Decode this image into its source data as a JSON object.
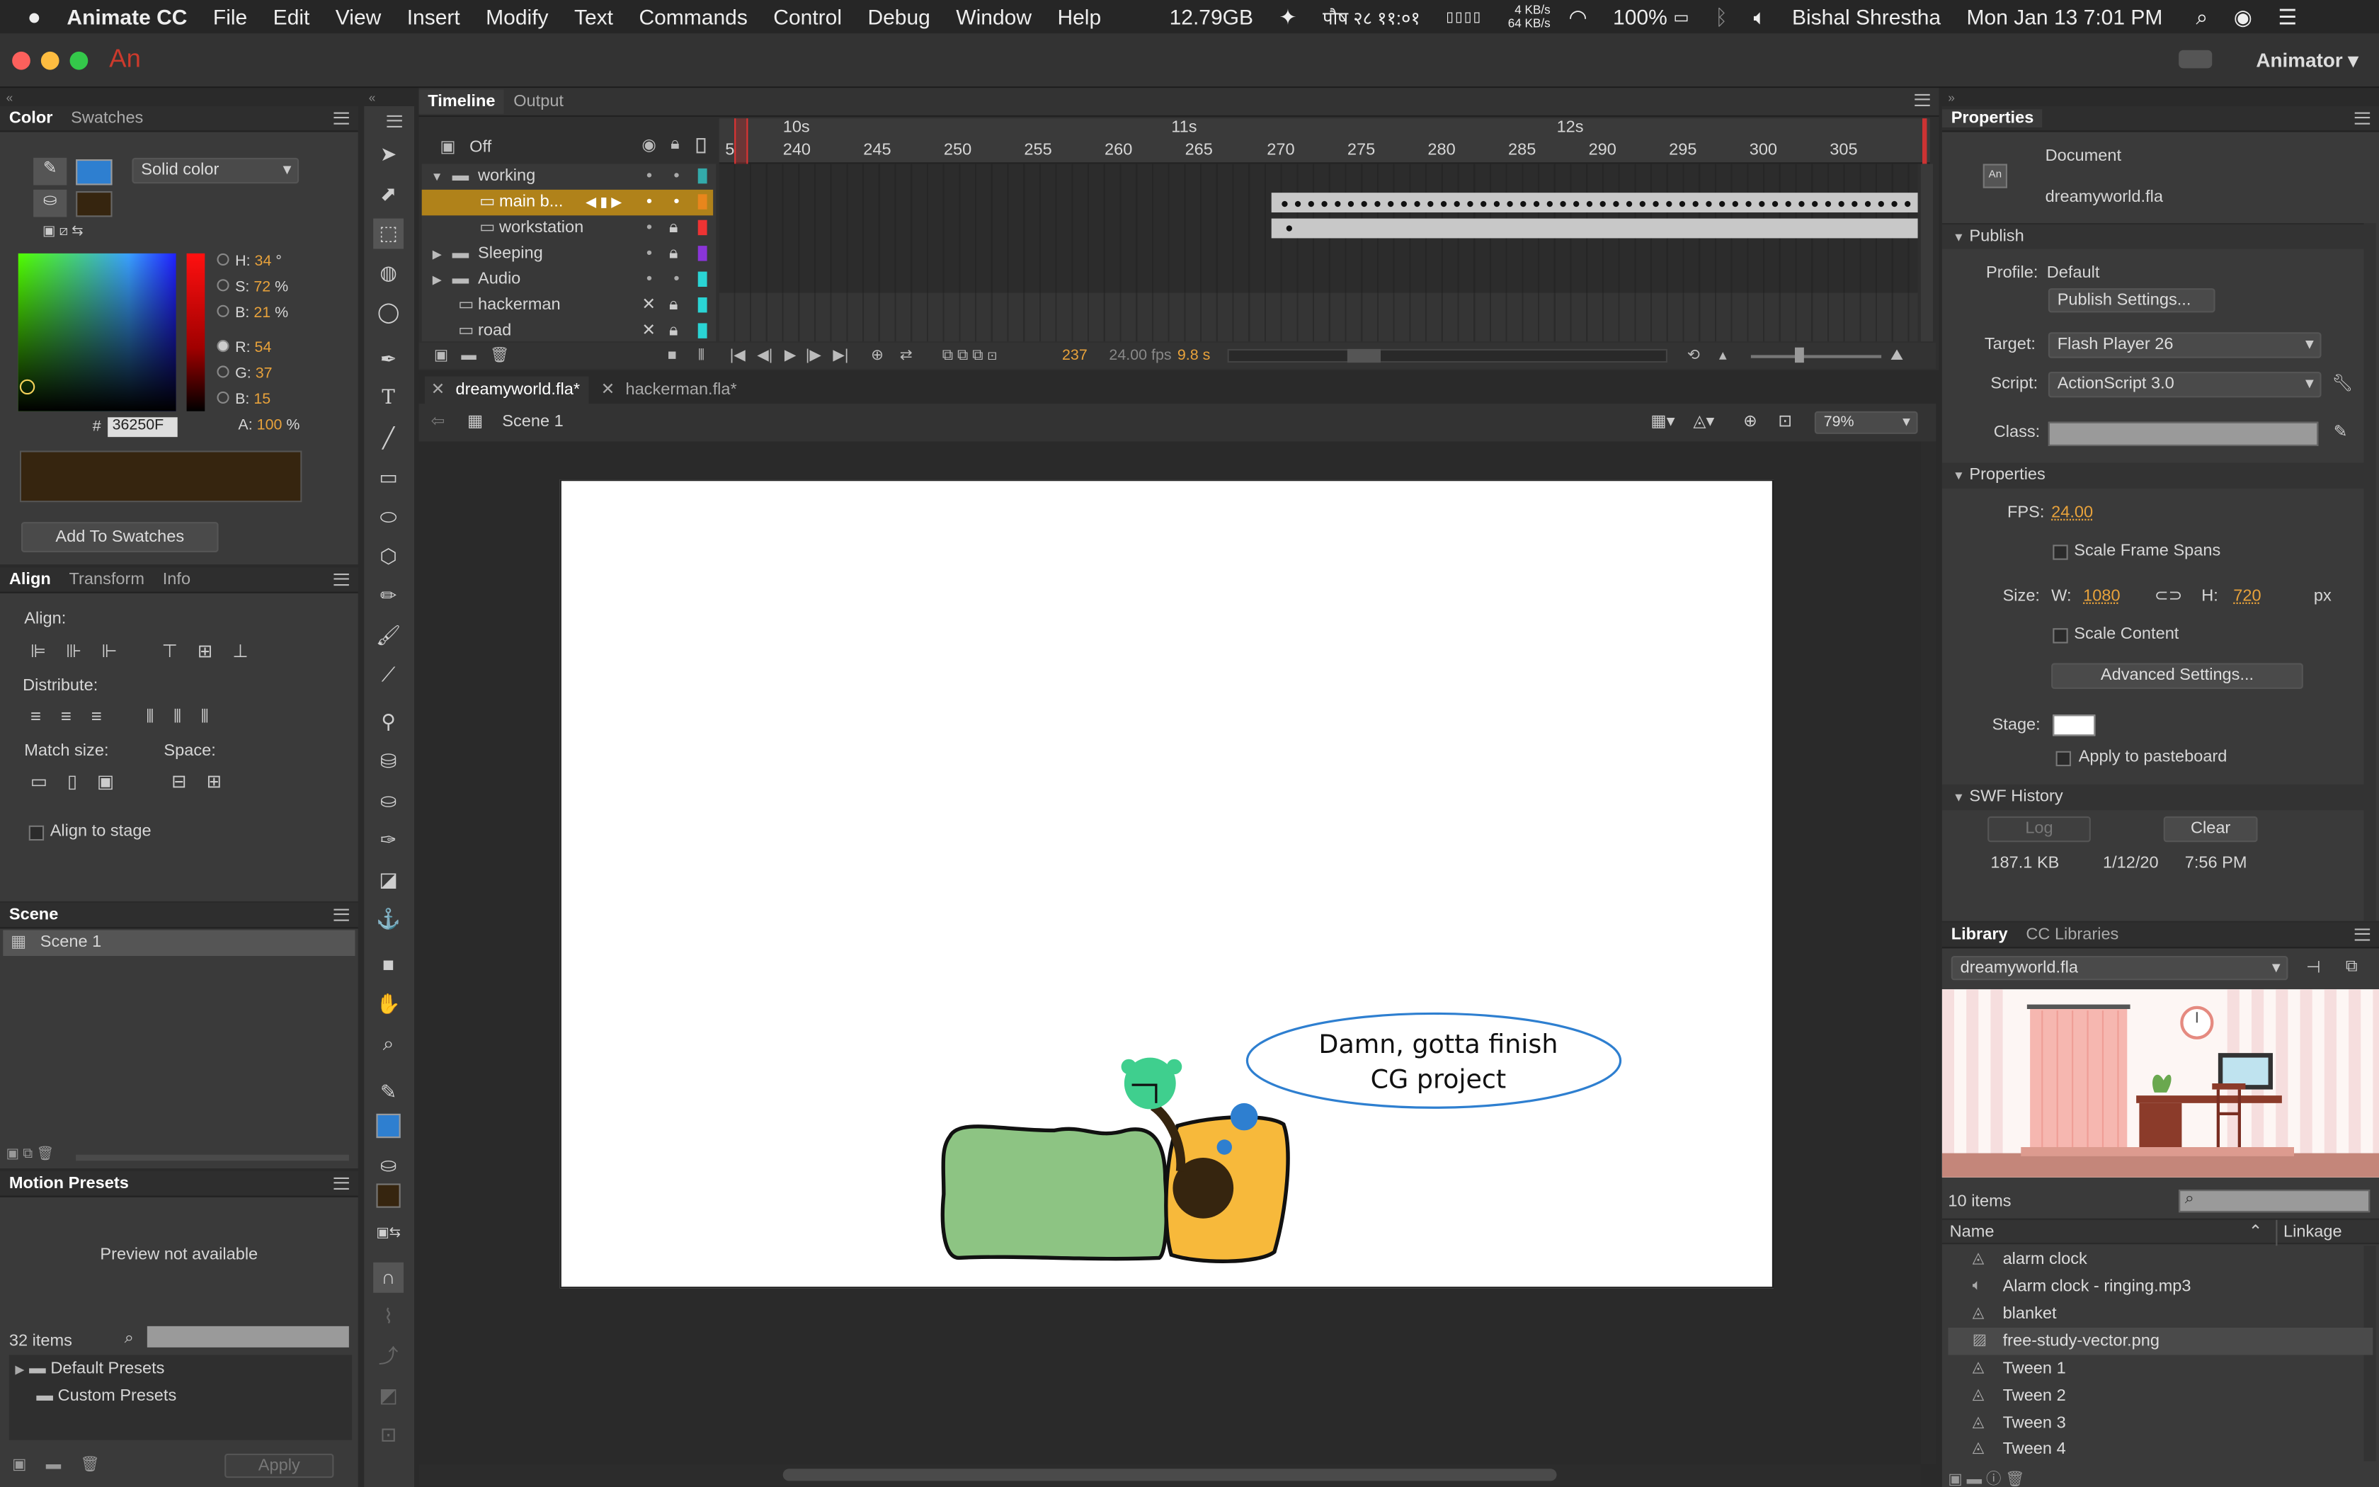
{
  "menubar": {
    "app": "Animate CC",
    "items": [
      "File",
      "Edit",
      "View",
      "Insert",
      "Modify",
      "Text",
      "Commands",
      "Control",
      "Debug",
      "Window",
      "Help"
    ],
    "memory": "12.79GB",
    "nepali_date": "पौष २८ ११:०१",
    "net_up": "4 KB/s",
    "net_down": "64 KB/s",
    "battery": "100%",
    "user": "Bishal Shrestha",
    "datetime": "Mon Jan 13  7:01 PM"
  },
  "titlebar": {
    "logo": "An",
    "workspace": "Animator"
  },
  "color_panel": {
    "tabs": [
      "Color",
      "Swatches"
    ],
    "fill_type": "Solid color",
    "hsb": [
      {
        "k": "H:",
        "v": "34",
        "u": "°"
      },
      {
        "k": "S:",
        "v": "72",
        "u": "%"
      },
      {
        "k": "B:",
        "v": "21",
        "u": "%"
      }
    ],
    "rgb": [
      {
        "k": "R:",
        "v": "54"
      },
      {
        "k": "G:",
        "v": "37"
      },
      {
        "k": "B:",
        "v": "15"
      }
    ],
    "alpha_label": "A:",
    "alpha": "100",
    "alpha_unit": "%",
    "hash": "#",
    "hex": "36250F",
    "swatch_color": "#36250F",
    "stroke_color": "#2e7fd0",
    "add_swatches": "Add To Swatches"
  },
  "align_panel": {
    "tabs": [
      "Align",
      "Transform",
      "Info"
    ],
    "align_label": "Align:",
    "distribute_label": "Distribute:",
    "match_label": "Match size:",
    "space_label": "Space:",
    "align_to_stage": "Align to stage"
  },
  "scene_panel": {
    "title": "Scene",
    "scenes": [
      "Scene 1"
    ]
  },
  "motion_presets": {
    "title": "Motion Presets",
    "preview": "Preview not available",
    "count": "32 items",
    "folders": [
      "Default Presets",
      "Custom Presets"
    ],
    "apply": "Apply"
  },
  "timeline": {
    "tabs": [
      "Timeline",
      "Output"
    ],
    "onion": "Off",
    "sec_labels": [
      "10s",
      "11s",
      "12s"
    ],
    "frame_labels": [
      "5",
      "240",
      "245",
      "250",
      "255",
      "260",
      "265",
      "270",
      "275",
      "280",
      "285",
      "290",
      "295",
      "300",
      "305"
    ],
    "layers": [
      {
        "name": "working",
        "type": "folder",
        "color": "#3aa",
        "indent": 0
      },
      {
        "name": "main b...",
        "type": "layer",
        "color": "#e8861c",
        "indent": 1
      },
      {
        "name": "workstation",
        "type": "layer",
        "color": "#e33",
        "indent": 1
      },
      {
        "name": "Sleeping",
        "type": "folder",
        "color": "#8a35d8",
        "indent": 0
      },
      {
        "name": "Audio",
        "type": "folder",
        "color": "#2ad4d4",
        "indent": 0
      },
      {
        "name": "hackerman",
        "type": "layer",
        "color": "#2ad4d4",
        "indent": 0
      },
      {
        "name": "road",
        "type": "layer",
        "color": "#2ad4d4",
        "indent": 0
      }
    ],
    "current_frame": "237",
    "fps": "24.00 fps",
    "time": "9.8 s"
  },
  "doc_tabs": [
    "dreamyworld.fla*",
    "hackerman.fla*"
  ],
  "edit_bar": {
    "scene": "Scene 1",
    "zoom": "79%"
  },
  "stage": {
    "bubble_line1": "Damn, gotta finish",
    "bubble_line2": "CG project"
  },
  "properties": {
    "title": "Properties",
    "doc_type": "Document",
    "doc_name": "dreamyworld.fla",
    "publish_section": "Publish",
    "profile_label": "Profile:",
    "profile": "Default",
    "publish_settings": "Publish Settings...",
    "target_label": "Target:",
    "target": "Flash Player 26",
    "script_label": "Script:",
    "script": "ActionScript 3.0",
    "class_label": "Class:",
    "props_section": "Properties",
    "fps_label": "FPS:",
    "fps": "24.00",
    "scale_frame_spans": "Scale Frame Spans",
    "size_label": "Size:",
    "w_label": "W:",
    "w": "1080",
    "h_label": "H:",
    "h": "720",
    "unit": "px",
    "scale_content": "Scale Content",
    "advanced": "Advanced Settings...",
    "stage_label": "Stage:",
    "apply_pasteboard": "Apply to pasteboard",
    "swf_section": "SWF History",
    "log": "Log",
    "clear": "Clear",
    "swf_size": "187.1 KB",
    "swf_date": "1/12/20",
    "swf_time": "7:56 PM"
  },
  "library": {
    "tabs": [
      "Library",
      "CC Libraries"
    ],
    "file": "dreamyworld.fla",
    "count": "10 items",
    "col_name": "Name",
    "col_linkage": "Linkage",
    "items": [
      {
        "name": "alarm clock",
        "icon": "symbol"
      },
      {
        "name": "Alarm clock - ringing.mp3",
        "icon": "sound"
      },
      {
        "name": "blanket",
        "icon": "symbol"
      },
      {
        "name": "free-study-vector.png",
        "icon": "bitmap"
      },
      {
        "name": "Tween 1",
        "icon": "symbol"
      },
      {
        "name": "Tween 2",
        "icon": "symbol"
      },
      {
        "name": "Tween 3",
        "icon": "symbol"
      },
      {
        "name": "Tween 4",
        "icon": "symbol"
      }
    ]
  }
}
